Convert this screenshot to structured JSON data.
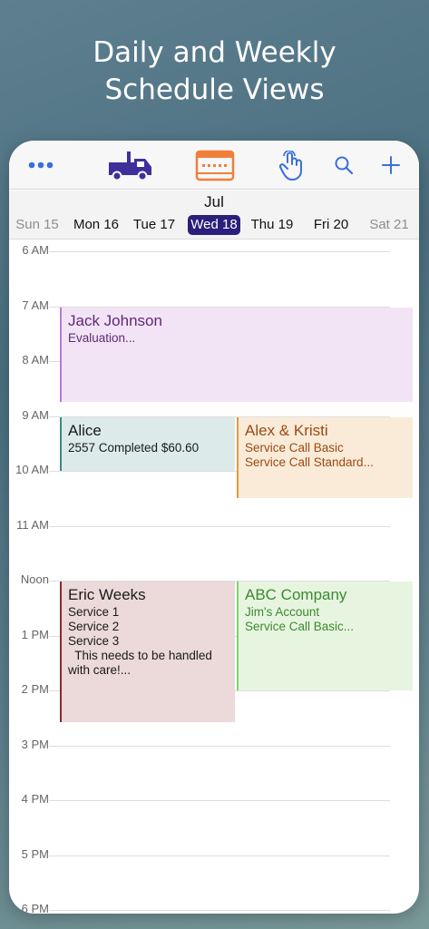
{
  "headline": {
    "line1": "Daily and Weekly",
    "line2": "Schedule Views"
  },
  "toolbar": {
    "icons": [
      "more-icon",
      "truck-icon",
      "calendar-week-icon",
      "tap-gesture-icon",
      "search-icon",
      "add-icon"
    ],
    "colors": {
      "blue": "#3a6fd8",
      "truck": "#3e2f9b",
      "calendar": "#f07f3a"
    }
  },
  "datebar": {
    "month": "Jul",
    "days": [
      {
        "label": "Sun 15",
        "state": "muted"
      },
      {
        "label": "Mon 16",
        "state": "normal"
      },
      {
        "label": "Tue 17",
        "state": "normal"
      },
      {
        "label": "Wed 18",
        "state": "selected"
      },
      {
        "label": "Thu 19",
        "state": "normal"
      },
      {
        "label": "Fri 20",
        "state": "normal"
      },
      {
        "label": "Sat 21",
        "state": "muted"
      }
    ],
    "selected_color": "#2a1f7a"
  },
  "hours": [
    "6 AM",
    "7 AM",
    "8 AM",
    "9 AM",
    "10 AM",
    "11 AM",
    "Noon",
    "1 PM",
    "2 PM",
    "3 PM",
    "4 PM",
    "5 PM",
    "6 PM"
  ],
  "events": [
    {
      "title": "Jack Johnson",
      "lines": [
        "Evaluation..."
      ],
      "start": "7:00 AM",
      "end": "8:45 AM",
      "column": "full",
      "colors": {
        "bg": "#f2e4f5",
        "bar": "#b57ccc",
        "text": "#5f2a73"
      }
    },
    {
      "title": "Alice",
      "lines": [
        "2557 Completed $60.60"
      ],
      "start": "9:00 AM",
      "end": "10:00 AM",
      "column": "left",
      "colors": {
        "bg": "#dcebea",
        "bar": "#3e8a80",
        "text": "#1a1a1a"
      }
    },
    {
      "title": "Alex & Kristi",
      "lines": [
        "Service Call Basic",
        "Service Call Standard..."
      ],
      "start": "9:00 AM",
      "end": "10:30 AM",
      "column": "right",
      "colors": {
        "bg": "#faebd9",
        "bar": "#e3993f",
        "text": "#9c4a12"
      }
    },
    {
      "title": "Eric Weeks",
      "lines": [
        "Service 1",
        "Service 2",
        "Service 3",
        "  This needs to be handled",
        "with care!..."
      ],
      "start": "Noon",
      "end": "2:35 PM",
      "column": "left",
      "colors": {
        "bg": "#ecd9d9",
        "bar": "#8b2a2a",
        "text": "#1a1a1a"
      }
    },
    {
      "title": "ABC Company",
      "lines": [
        "Jim's Account",
        "Service Call Basic..."
      ],
      "start": "Noon",
      "end": "2:00 PM",
      "column": "right",
      "colors": {
        "bg": "#e7f5e0",
        "bar": "#7fd36a",
        "text": "#3c8a2e"
      }
    }
  ]
}
